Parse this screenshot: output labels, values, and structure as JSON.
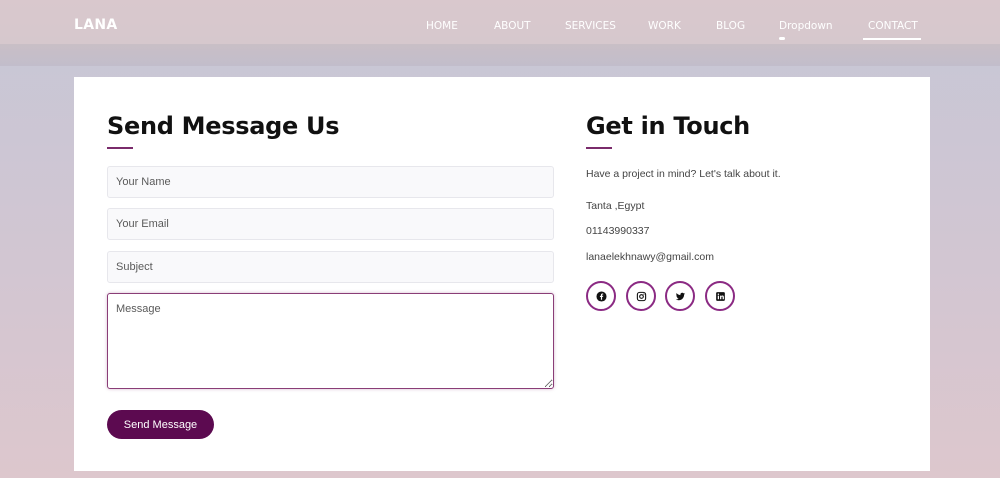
{
  "header": {
    "logo": "LANA",
    "nav": [
      {
        "label": "HOME"
      },
      {
        "label": "ABOUT"
      },
      {
        "label": "SERVICES"
      },
      {
        "label": "WORK"
      },
      {
        "label": "BLOG"
      },
      {
        "label": "Dropdown"
      },
      {
        "label": "CONTACT"
      }
    ],
    "active_item": "CONTACT"
  },
  "form": {
    "title": "Send Message Us",
    "name_placeholder": "Your Name",
    "email_placeholder": "Your Email",
    "subject_placeholder": "Subject",
    "message_placeholder": "Message",
    "submit_label": "Send Message"
  },
  "contact": {
    "title": "Get in Touch",
    "intro": "Have a project in mind? Let's talk about it.",
    "location": "Tanta ,Egypt",
    "phone": "01143990337",
    "email": "lanaelekhnawy@gmail.com",
    "socials": [
      {
        "icon": "facebook-icon"
      },
      {
        "icon": "instagram-icon"
      },
      {
        "icon": "twitter-icon"
      },
      {
        "icon": "linkedin-icon"
      }
    ]
  },
  "colors": {
    "accent": "#5c0a50",
    "accent_border": "#8b2a83",
    "underline": "#7a2b6b"
  }
}
